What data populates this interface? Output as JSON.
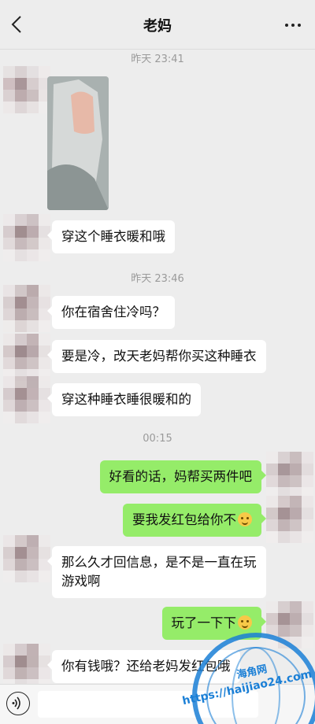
{
  "header": {
    "title": "老妈"
  },
  "timestamps": [
    "昨天 23:41",
    "昨天 23:46",
    "00:15"
  ],
  "messages": {
    "m1": "穿这个睡衣暖和哦",
    "m2": "你在宿舍住冷吗？",
    "m3": "要是冷，改天老妈帮你买这种睡衣",
    "m4": "穿这种睡衣睡很暖和的",
    "m5": "好看的话，妈帮买两件吧",
    "m6": "要我发红包给你不",
    "m7": "那么久才回信息，是不是一直在玩游戏啊",
    "m8": "玩了一下下",
    "m9": "你有钱哦？还给老妈发红包哦"
  },
  "watermark": {
    "cn": "海角网",
    "url": "https://haijiao24.com"
  },
  "colors": {
    "background": "#ededed",
    "incoming": "#ffffff",
    "outgoing": "#95ec69",
    "watermark": "#1a7fd6"
  },
  "icons": {
    "back": "chevron-left-icon",
    "more": "more-dots-icon",
    "voice": "voice-icon",
    "emoji": "emoji-icon"
  }
}
